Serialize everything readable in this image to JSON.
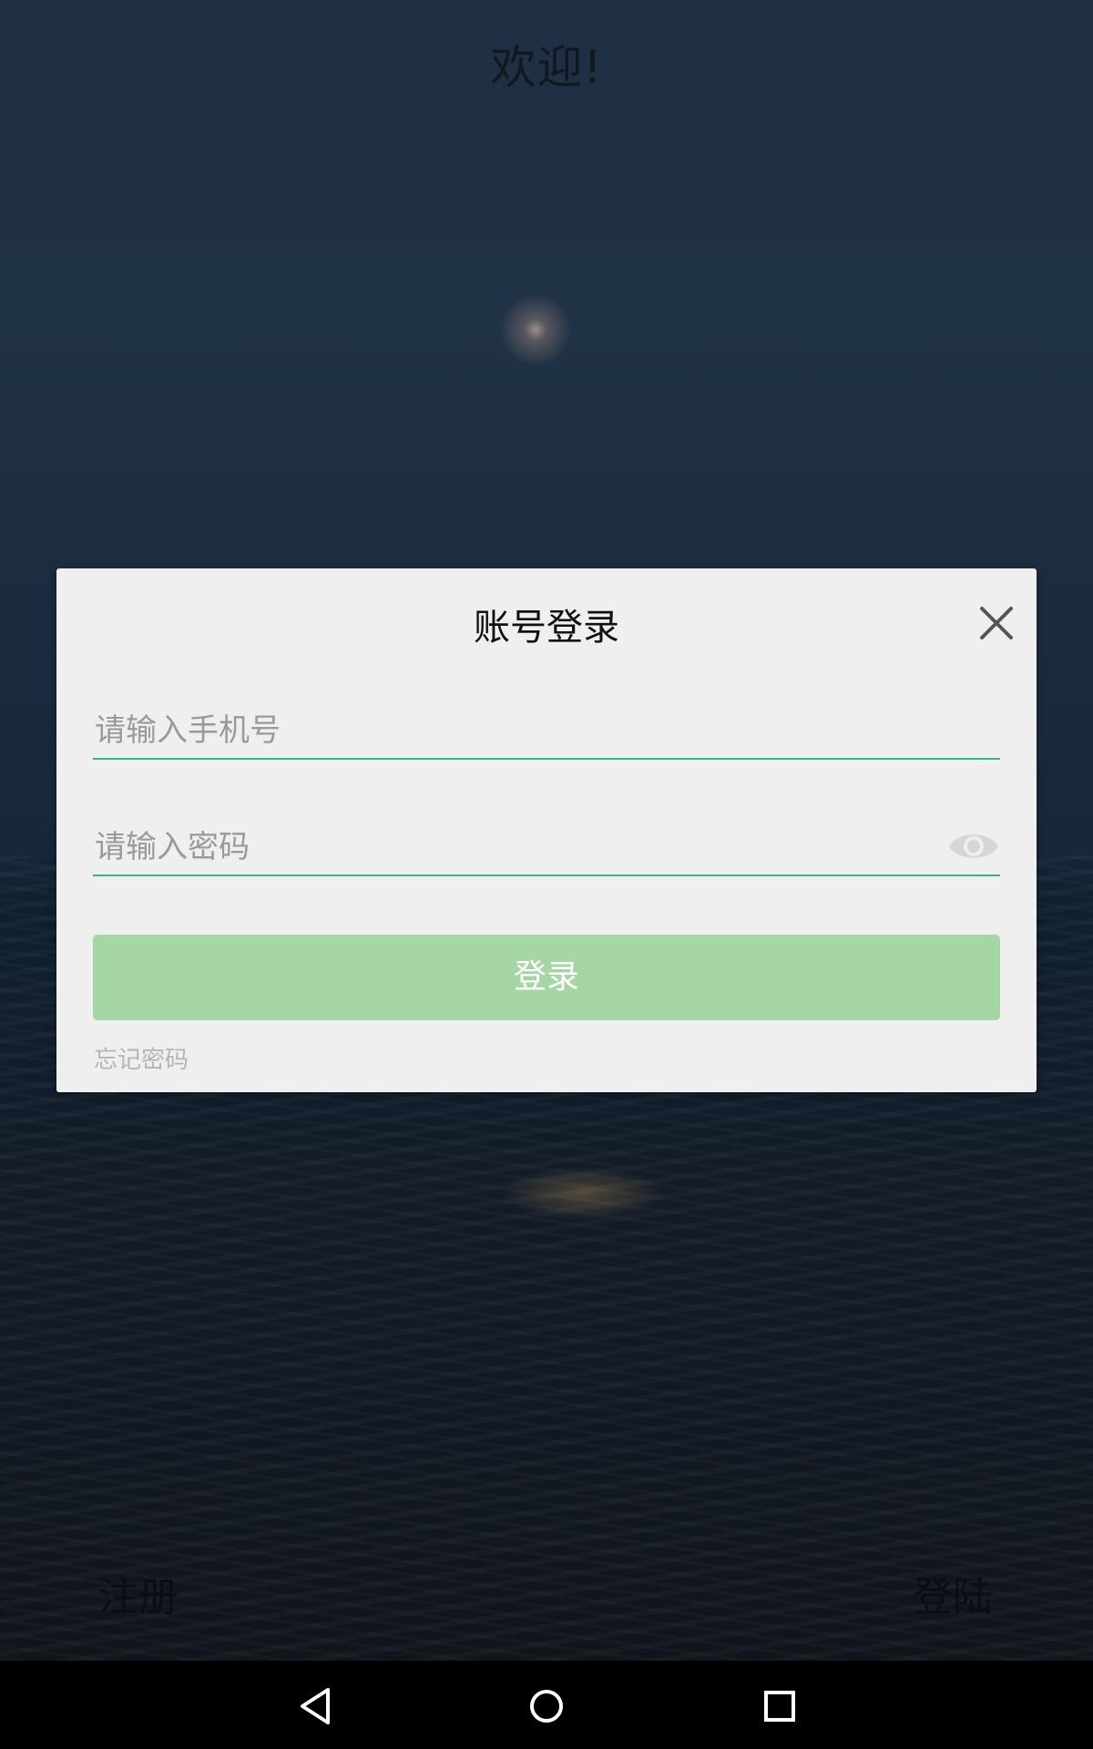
{
  "header": {
    "welcome_text": "欢迎!"
  },
  "dialog": {
    "title": "账号登录",
    "close_icon": "close-icon",
    "phone_field": {
      "placeholder": "请输入手机号",
      "value": ""
    },
    "password_field": {
      "placeholder": "请输入密码",
      "value": "",
      "toggle_icon": "eye-icon"
    },
    "login_button_label": "登录",
    "forgot_password_label": "忘记密码"
  },
  "footer": {
    "register_label": "注册",
    "login_label": "登陆"
  },
  "navbar": {
    "icons": [
      "back-icon",
      "home-icon",
      "recents-icon"
    ]
  },
  "colors": {
    "accent": "#3bb37a",
    "login_button": "#a6d6a5",
    "dialog_background": "#efefef"
  }
}
